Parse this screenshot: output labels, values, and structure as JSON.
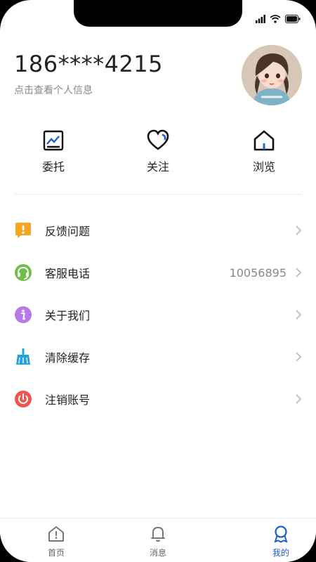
{
  "profile": {
    "phone": "186****4215",
    "subtitle": "点击查看个人信息"
  },
  "quick_actions": [
    {
      "label": "委托",
      "icon": "chart-icon"
    },
    {
      "label": "关注",
      "icon": "heart-icon"
    },
    {
      "label": "浏览",
      "icon": "home-icon"
    }
  ],
  "menu": [
    {
      "label": "反馈问题",
      "icon": "feedback-icon",
      "value": ""
    },
    {
      "label": "客服电话",
      "icon": "headset-icon",
      "value": "10056895"
    },
    {
      "label": "关于我们",
      "icon": "info-icon",
      "value": ""
    },
    {
      "label": "清除缓存",
      "icon": "broom-icon",
      "value": ""
    },
    {
      "label": "注销账号",
      "icon": "power-icon",
      "value": ""
    }
  ],
  "tabbar": {
    "items": [
      {
        "label": "首页",
        "icon": "home-tab-icon",
        "active": false
      },
      {
        "label": "消息",
        "icon": "bell-icon",
        "active": false
      },
      {
        "label": "我的",
        "icon": "profile-tab-icon",
        "active": true
      }
    ]
  },
  "colors": {
    "accent": "#1e5bd6",
    "feedback": "#f5a623",
    "headset": "#6cc04a",
    "info": "#b77ae8",
    "broom": "#1fa3e0",
    "power": "#e9574f"
  }
}
